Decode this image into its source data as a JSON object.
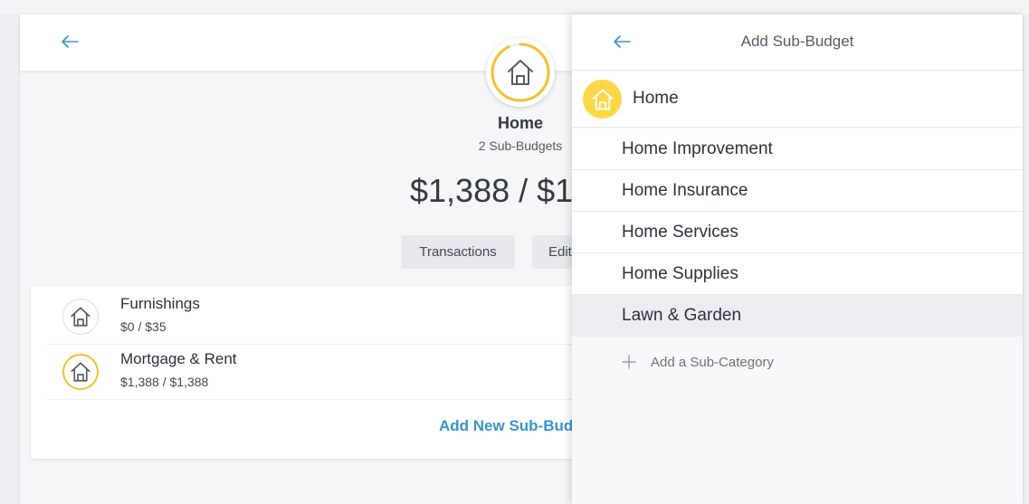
{
  "colors": {
    "accent_blue": "#3a93c8",
    "gold": "#f2c12e",
    "yellow_fill": "#fcd848",
    "icon_gray": "#545b63",
    "selected_row": "#ebedf2"
  },
  "main": {
    "back_icon": "arrow-left-icon",
    "category_icon": "house-icon",
    "title": "Home",
    "subtitle": "2 Sub-Budgets",
    "amount": "$1,388 / $1,",
    "progress_fraction": 0.93,
    "buttons": {
      "transactions": "Transactions",
      "edit": "Edit"
    },
    "sub_budgets": [
      {
        "name": "Furnishings",
        "amount": "$0 / $35",
        "icon": "house-icon",
        "ring": "gray"
      },
      {
        "name": "Mortgage & Rent",
        "amount": "$1,388 / $1,388",
        "icon": "house-icon",
        "ring": "gold"
      }
    ],
    "add_link": "Add New Sub-Bud"
  },
  "panel": {
    "back_icon": "arrow-left-icon",
    "title": "Add Sub-Budget",
    "parent": {
      "label": "Home",
      "icon": "house-icon"
    },
    "items": [
      {
        "label": "Home Improvement",
        "selected": false
      },
      {
        "label": "Home Insurance",
        "selected": false
      },
      {
        "label": "Home Services",
        "selected": false
      },
      {
        "label": "Home Supplies",
        "selected": false
      },
      {
        "label": "Lawn & Garden",
        "selected": true
      }
    ],
    "add_sub_category": {
      "label": "Add a Sub-Category",
      "icon": "plus-icon"
    }
  }
}
